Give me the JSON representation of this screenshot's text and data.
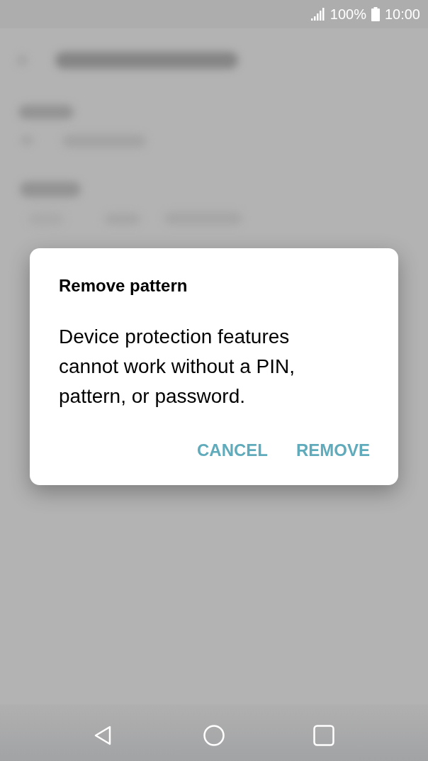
{
  "status_bar": {
    "battery": "100%",
    "time": "10:00"
  },
  "dialog": {
    "title": "Remove pattern",
    "message": "Device protection features cannot work without a PIN, pattern, or password.",
    "buttons": [
      {
        "label": "CANCEL"
      },
      {
        "label": "REMOVE"
      }
    ]
  }
}
